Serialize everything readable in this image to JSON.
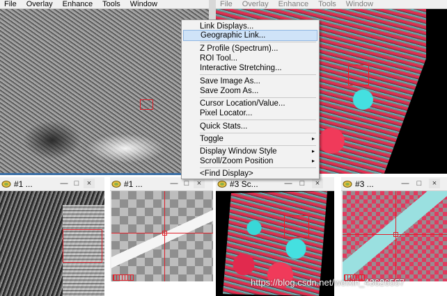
{
  "left_window": {
    "menu": [
      "File",
      "Overlay",
      "Enhance",
      "Tools",
      "Window"
    ]
  },
  "right_window": {
    "menu": [
      "File",
      "Overlay",
      "Enhance",
      "Tools",
      "Window"
    ]
  },
  "context_menu": {
    "items": [
      {
        "label": "Link Displays..."
      },
      {
        "label": "Geographic Link..."
      },
      {
        "label": "Z Profile (Spectrum)..."
      },
      {
        "label": "ROI Tool..."
      },
      {
        "label": "Interactive Stretching..."
      },
      {
        "label": "Save Image As..."
      },
      {
        "label": "Save Zoom As..."
      },
      {
        "label": "Cursor Location/Value..."
      },
      {
        "label": "Pixel Locator..."
      },
      {
        "label": "Quick Stats..."
      },
      {
        "label": "Toggle"
      },
      {
        "label": "Display Window Style"
      },
      {
        "label": "Scroll/Zoom Position"
      },
      {
        "label": "<Find Display>"
      }
    ],
    "highlighted_index": 1,
    "submenu_arrow": "▸"
  },
  "small_windows": [
    {
      "title": "#1 ...",
      "minimize": "—",
      "maximize": "□",
      "close": "×"
    },
    {
      "title": "#1 ...",
      "minimize": "—",
      "maximize": "□",
      "close": "×"
    },
    {
      "title": "#3 Sc...",
      "minimize": "—",
      "maximize": "□",
      "close": "×"
    },
    {
      "title": "#3 ...",
      "minimize": "—",
      "maximize": "□",
      "close": "×"
    }
  ],
  "watermark": "https://blog.csdn.net/weixin_43626557",
  "colors": {
    "menu_bg": "#f0f0f0",
    "highlight": "#cfe3f8",
    "crosshair": "#e0202a",
    "cyan": "#38d8d8",
    "magenta_red": "#e6294e"
  },
  "icons": {
    "window_icon": "envi-display-icon",
    "submenu": "chevron-right-icon"
  }
}
